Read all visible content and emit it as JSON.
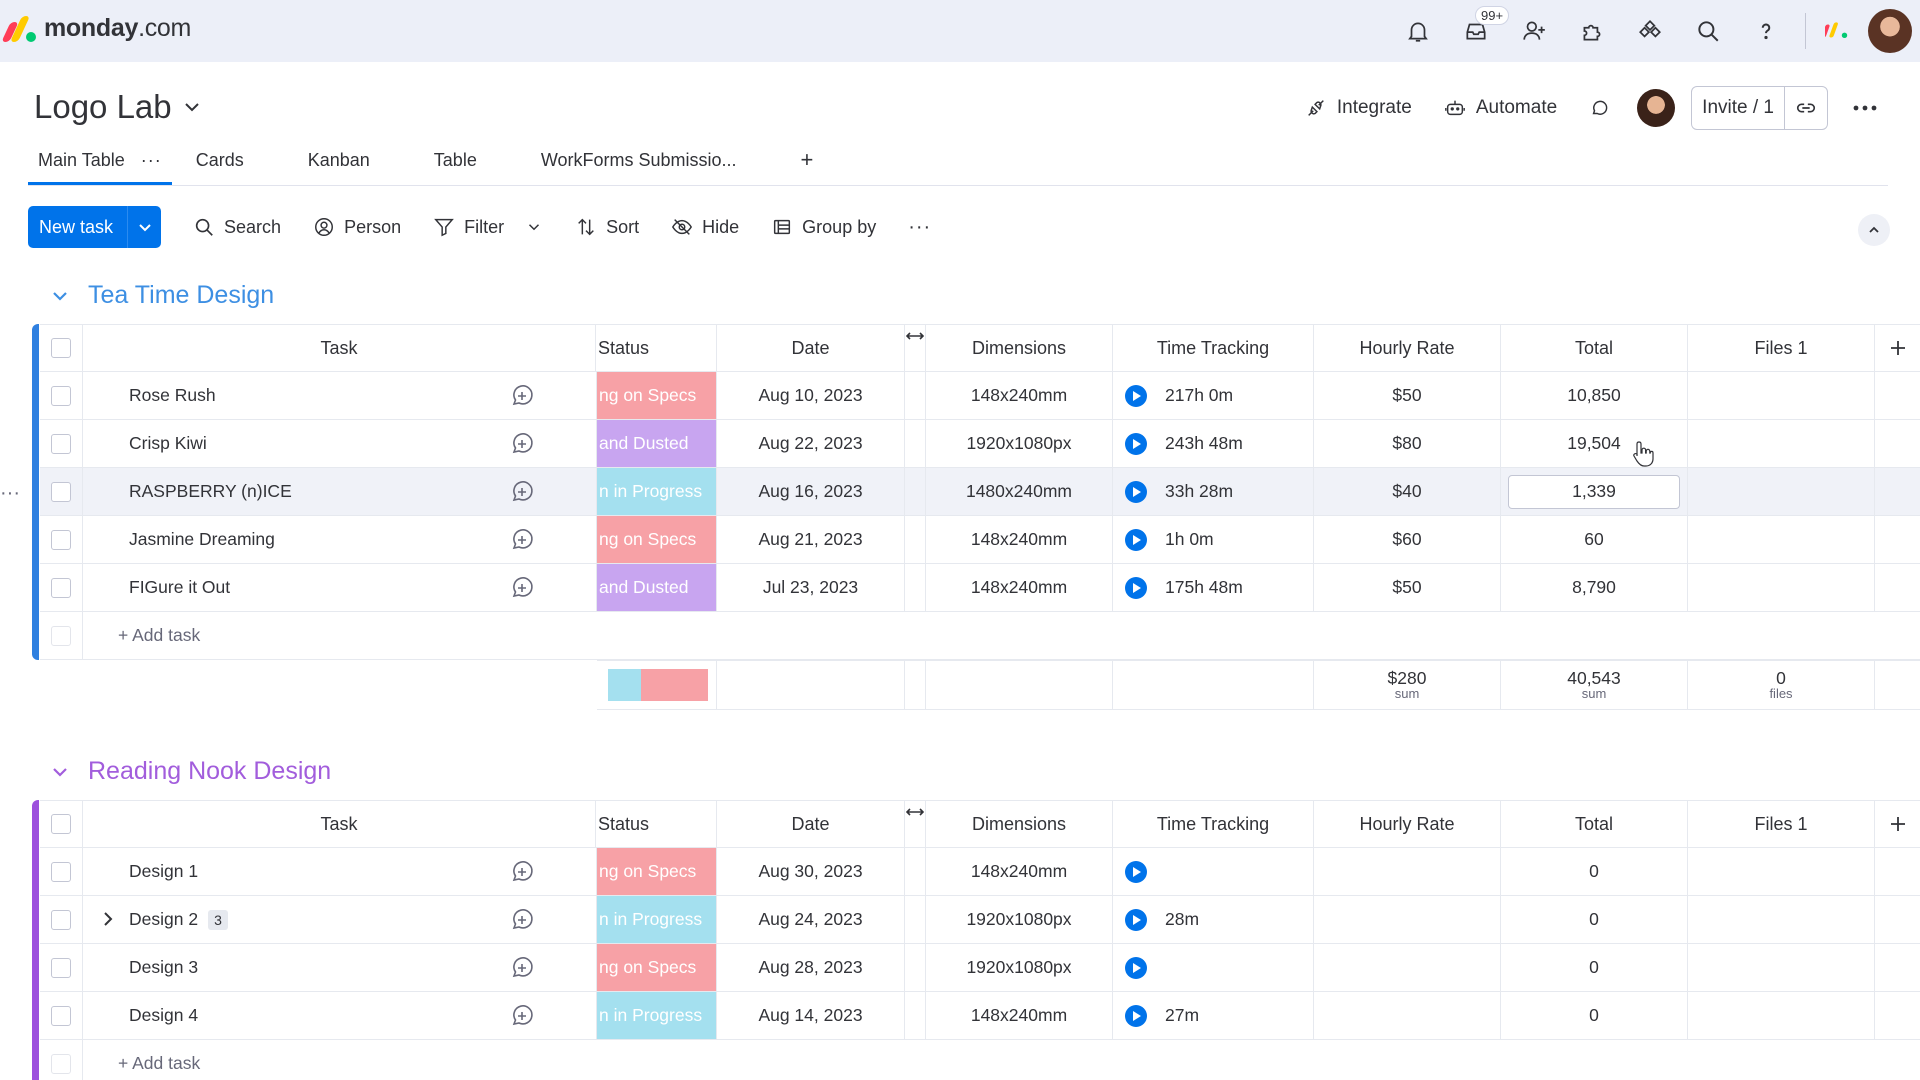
{
  "topbar": {
    "logo_brand": "monday",
    "logo_suffix": ".com",
    "logo_colors": [
      "#ff3d57",
      "#ffcb00",
      "#00ca72"
    ],
    "notifications_badge": "99+",
    "icons": [
      "bell-icon",
      "inbox-icon",
      "invite-members-icon",
      "apps-icon",
      "marketplace-icon",
      "search-icon",
      "help-icon",
      "product-switcher-icon",
      "avatar"
    ]
  },
  "board": {
    "title": "Logo Lab",
    "integrate_label": "Integrate",
    "automate_label": "Automate",
    "invite_label": "Invite / 1"
  },
  "tabs": [
    {
      "label": "Main Table",
      "active": true
    },
    {
      "label": "Cards"
    },
    {
      "label": "Kanban"
    },
    {
      "label": "Table"
    },
    {
      "label": "WorkForms Submissio..."
    }
  ],
  "tab_more": "···",
  "tab_add": "+",
  "toolbar": {
    "new_task": "New task",
    "search": "Search",
    "person": "Person",
    "filter": "Filter",
    "sort": "Sort",
    "hide": "Hide",
    "group_by": "Group by",
    "more": "···"
  },
  "columns": {
    "task": "Task",
    "status": "Status",
    "date": "Date",
    "dimensions": "Dimensions",
    "time_tracking": "Time Tracking",
    "hourly_rate": "Hourly Rate",
    "total": "Total",
    "files": "Files 1"
  },
  "colors": {
    "accent": "#0073ea",
    "status_working": "#f7a1a6",
    "status_done": "#c8a5f0",
    "status_progress": "#a4e0ef",
    "group1": "#2f80e0",
    "group2": "#9d50dd"
  },
  "groups": [
    {
      "title": "Tea Time Design",
      "color": "#2f80e0",
      "title_color": "#3d8fe3",
      "rows": [
        {
          "task": "Rose Rush",
          "status": "ng on Specs",
          "status_color": "#f7a1a6",
          "date": "Aug 10, 2023",
          "dimensions": "148x240mm",
          "time": "217h 0m",
          "rate": "$50",
          "total": "10,850"
        },
        {
          "task": "Crisp Kiwi",
          "status": "and Dusted",
          "status_color": "#c8a5f0",
          "date": "Aug 22, 2023",
          "dimensions": "1920x1080px",
          "time": "243h 48m",
          "rate": "$80",
          "total": "19,504"
        },
        {
          "task": "RASPBERRY (n)ICE",
          "status": "n in Progress",
          "status_color": "#a4e0ef",
          "date": "Aug 16, 2023",
          "dimensions": "1480x240mm",
          "time": "33h 28m",
          "rate": "$40",
          "total": "1,339",
          "highlight": true
        },
        {
          "task": "Jasmine Dreaming",
          "status": "ng on Specs",
          "status_color": "#f7a1a6",
          "date": "Aug 21, 2023",
          "dimensions": "148x240mm",
          "time": "1h 0m",
          "rate": "$60",
          "total": "60"
        },
        {
          "task": "FIGure it Out",
          "status": "and Dusted",
          "status_color": "#c8a5f0",
          "date": "Jul 23, 2023",
          "dimensions": "148x240mm",
          "time": "175h 48m",
          "rate": "$50",
          "total": "8,790"
        }
      ],
      "add_task": "+ Add task",
      "summary": {
        "status_split": [
          {
            "color": "#a4e0ef",
            "share": 0.33
          },
          {
            "color": "#f7a1a6",
            "share": 0.67
          }
        ],
        "rate": "$280",
        "rate_label": "sum",
        "total": "40,543",
        "total_label": "sum",
        "files": "0",
        "files_label": "files"
      }
    },
    {
      "title": "Reading Nook Design",
      "color": "#9d50dd",
      "title_color": "#a25ddc",
      "rows": [
        {
          "task": "Design 1",
          "status": "ng on Specs",
          "status_color": "#f7a1a6",
          "date": "Aug 30, 2023",
          "dimensions": "148x240mm",
          "time": "",
          "rate": "",
          "total": "0"
        },
        {
          "task": "Design 2",
          "subitems": "3",
          "status": "n in Progress",
          "status_color": "#a4e0ef",
          "date": "Aug 24, 2023",
          "dimensions": "1920x1080px",
          "time": "28m",
          "rate": "",
          "total": "0"
        },
        {
          "task": "Design 3",
          "status": "ng on Specs",
          "status_color": "#f7a1a6",
          "date": "Aug 28, 2023",
          "dimensions": "1920x1080px",
          "time": "",
          "rate": "",
          "total": "0"
        },
        {
          "task": "Design 4",
          "status": "n in Progress",
          "status_color": "#a4e0ef",
          "date": "Aug 14, 2023",
          "dimensions": "148x240mm",
          "time": "27m",
          "rate": "",
          "total": "0"
        }
      ],
      "add_task": "+ Add task"
    }
  ],
  "row_menu": "···"
}
